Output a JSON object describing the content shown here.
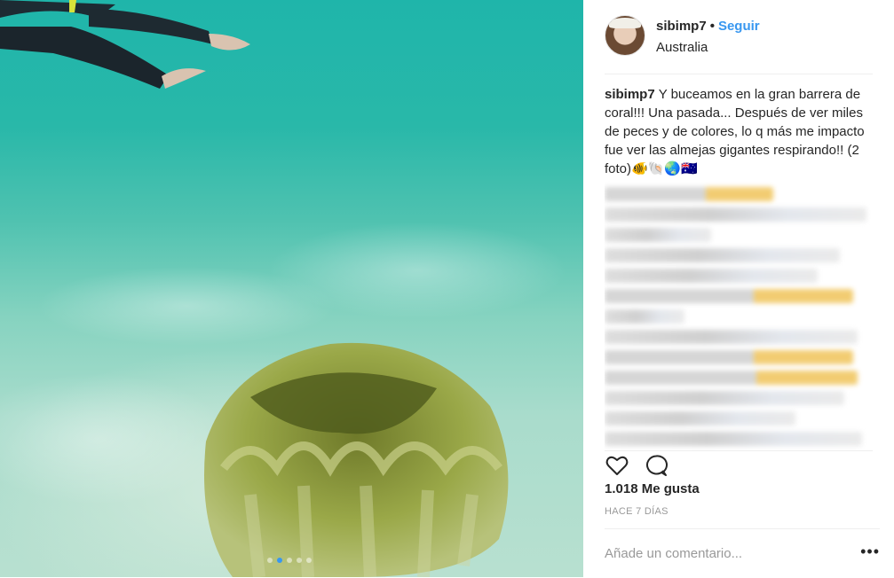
{
  "post": {
    "username": "sibimp7",
    "separator": "•",
    "follow_label": "Seguir",
    "location": "Australia",
    "caption_author": "sibimp7",
    "caption_text": "Y buceamos en la gran barrera de coral!!! Una pasada... Después de ver miles de peces y de colores, lo q más me impacto fue ver las almejas gigantes respirando!! (2 foto)🐠🐚🌏🇦🇺",
    "likes": "1.018 Me gusta",
    "time": "HACE 7 DÍAS",
    "comment_placeholder": "Añade un comentario...",
    "more_label": "•••"
  },
  "carousel": {
    "count": 5,
    "active_index": 1
  },
  "icons": {
    "like": "heart-outline-icon",
    "comment": "speech-bubble-icon",
    "more": "ellipsis-icon"
  },
  "colors": {
    "accent": "#3897f0",
    "text": "#262626",
    "muted": "#999999",
    "divider": "#efefef"
  }
}
